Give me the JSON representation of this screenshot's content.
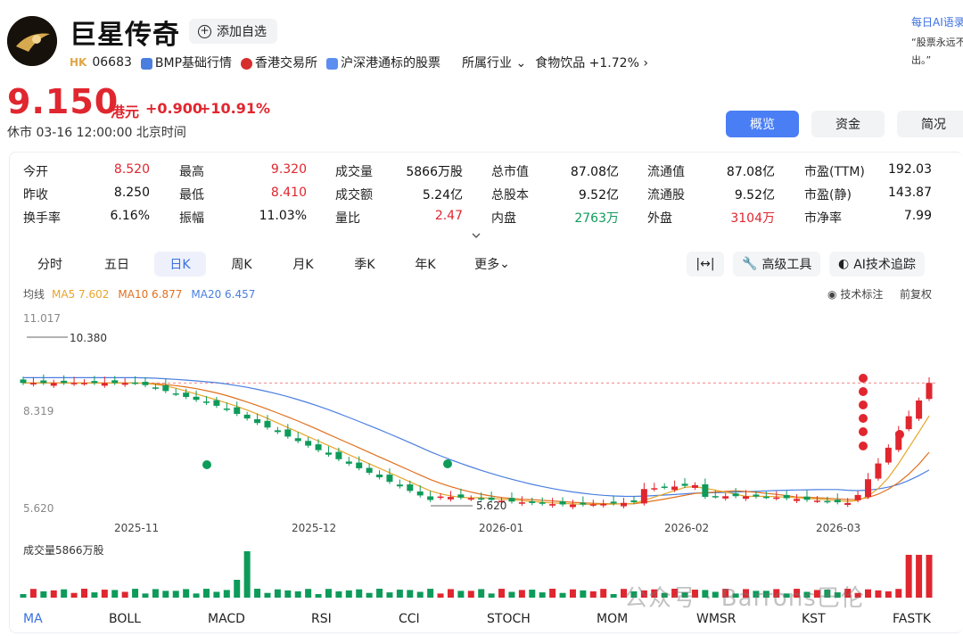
{
  "header": {
    "name": "巨星传奇",
    "add_watch": "添加自选",
    "market_tag": "HK",
    "code": "06683",
    "links": [
      "BMP基础行情",
      "香港交易所",
      "沪深港通标的股票"
    ],
    "industry_label": "所属行业",
    "industry_value": "食物饮品 +1.72%"
  },
  "ai_side": {
    "title": "每日AI语录",
    "text_1": "“股票永远不",
    "text_2": "出。”"
  },
  "quote": {
    "price": "9.150",
    "currency": "港元",
    "change": "+0.900",
    "pct": "+10.91%",
    "status": "休市 03-16 12:00:00 北京时间"
  },
  "tabs": [
    "概览",
    "资金",
    "简况"
  ],
  "stats": [
    [
      {
        "label": "今开",
        "value": "8.520",
        "color": "red"
      },
      {
        "label": "最高",
        "value": "9.320",
        "color": "red"
      },
      {
        "label": "成交量",
        "value": "5866万股",
        "color": ""
      },
      {
        "label": "总市值",
        "value": "87.08亿",
        "color": ""
      },
      {
        "label": "流通值",
        "value": "87.08亿",
        "color": ""
      },
      {
        "label": "市盈(TTM)",
        "value": "192.03",
        "color": ""
      }
    ],
    [
      {
        "label": "昨收",
        "value": "8.250",
        "color": ""
      },
      {
        "label": "最低",
        "value": "8.410",
        "color": "red"
      },
      {
        "label": "成交额",
        "value": "5.24亿",
        "color": ""
      },
      {
        "label": "总股本",
        "value": "9.52亿",
        "color": ""
      },
      {
        "label": "流通股",
        "value": "9.52亿",
        "color": ""
      },
      {
        "label": "市盈(静)",
        "value": "143.87",
        "color": ""
      }
    ],
    [
      {
        "label": "换手率",
        "value": "6.16%",
        "color": ""
      },
      {
        "label": "振幅",
        "value": "11.03%",
        "color": ""
      },
      {
        "label": "量比",
        "value": "2.47",
        "color": "red"
      },
      {
        "label": "内盘",
        "value": "2763万",
        "color": "green"
      },
      {
        "label": "外盘",
        "value": "3104万",
        "color": "red"
      },
      {
        "label": "市净率",
        "value": "7.99",
        "color": ""
      }
    ]
  ],
  "periods": [
    "分时",
    "五日",
    "日K",
    "周K",
    "月K",
    "季K",
    "年K",
    "更多"
  ],
  "tools": {
    "advanced": "高级工具",
    "ai_track": "AI技术追踪"
  },
  "ma": {
    "label": "均线",
    "ma5": "MA5 7.602",
    "ma10": "MA10 6.877",
    "ma20": "MA20 6.457"
  },
  "chart_opts": {
    "tech": "技术标注",
    "adj": "前复权"
  },
  "chart_data": {
    "type": "candlestick",
    "y_labels": [
      "11.017",
      "8.319",
      "5.620"
    ],
    "ylim": [
      5.62,
      11.017
    ],
    "high_annotation": "10.380",
    "low_annotation": "5.620",
    "x_labels": [
      "2025-11",
      "2025-12",
      "2026-01",
      "2026-02",
      "2026-03"
    ],
    "volume_label": "成交量5866万股",
    "last_close": 9.15
  },
  "indicators": [
    "MA",
    "BOLL",
    "MACD",
    "RSI",
    "CCI",
    "STOCH",
    "MOM",
    "WMSR",
    "KST",
    "FASTK"
  ],
  "watermark": "公众号 · Barrons巴伦"
}
